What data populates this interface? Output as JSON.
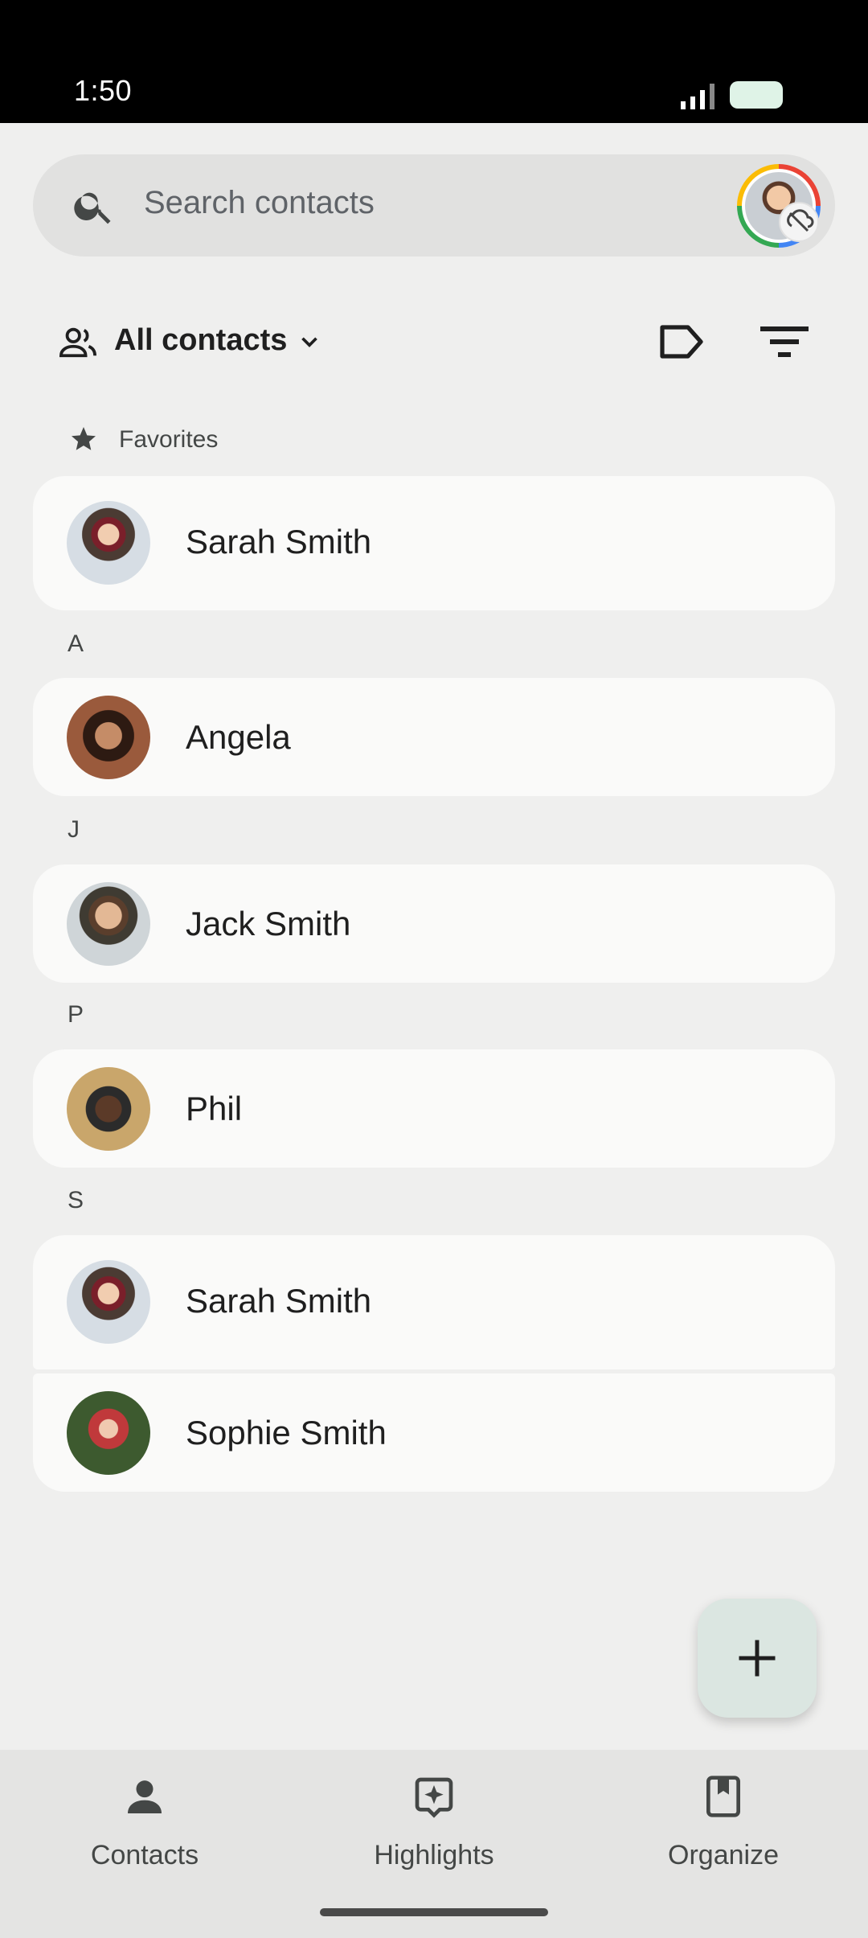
{
  "status_bar": {
    "time": "1:50"
  },
  "search": {
    "placeholder": "Search contacts"
  },
  "filter": {
    "label": "All contacts"
  },
  "favorites_header": "Favorites",
  "sections": [
    {
      "letter": "A"
    },
    {
      "letter": "J"
    },
    {
      "letter": "P"
    },
    {
      "letter": "S"
    }
  ],
  "contacts": {
    "favorite": [
      {
        "name": "Sarah Smith"
      }
    ],
    "A": [
      {
        "name": "Angela"
      }
    ],
    "J": [
      {
        "name": "Jack Smith"
      }
    ],
    "P": [
      {
        "name": "Phil"
      }
    ],
    "S": [
      {
        "name": "Sarah Smith"
      },
      {
        "name": "Sophie Smith"
      }
    ]
  },
  "bottom_nav": {
    "items": [
      {
        "label": "Contacts",
        "icon": "person-icon"
      },
      {
        "label": "Highlights",
        "icon": "sparkle-icon"
      },
      {
        "label": "Organize",
        "icon": "bookmark-icon"
      }
    ]
  },
  "colors": {
    "background": "#efefee",
    "card": "#fafaf9",
    "fab": "#dbe6e1",
    "nav": "#e4e4e3"
  }
}
